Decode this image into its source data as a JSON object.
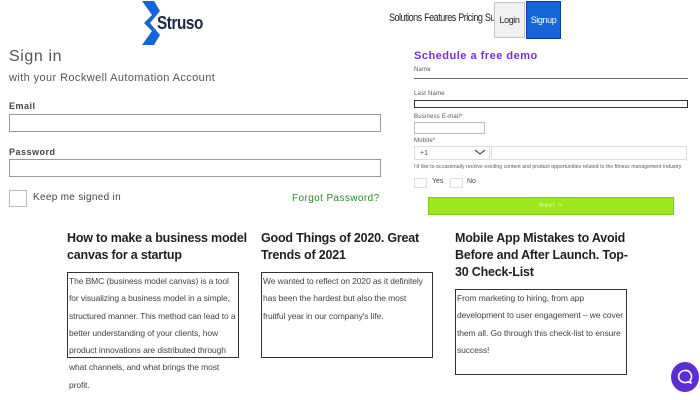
{
  "header": {
    "logo_text": "Struso",
    "nav": [
      "Solutions",
      "Features",
      "Pricing",
      "Support"
    ],
    "login_label": "Login",
    "signup_label": "Signup",
    "colors": {
      "logo_blue": "#1565d8",
      "signup_blue": "#1565d8"
    }
  },
  "signin": {
    "title": "Sign in",
    "subtitle": "with your Rockwell Automation Account",
    "email_label": "Email",
    "email_value": "",
    "password_label": "Password",
    "password_value": "",
    "keep_signed_in_label": "Keep me signed in",
    "forgot_label": "Forgot Password?"
  },
  "demo": {
    "title": "Schedule a free demo",
    "name_label": "Name",
    "lastname_label": "Last Name",
    "business_email_label": "Business E-mail*",
    "mobile_label": "Mobile*",
    "country_code": "+1",
    "consent_text": "I'd like to occasionally receive exciting content and product opportunities related to the fitness management industry",
    "yes_label": "Yes",
    "no_label": "No",
    "next_label": "Next  >",
    "colors": {
      "title": "#7b2ce0",
      "next_button": "#9be81c"
    }
  },
  "articles": [
    {
      "title": "How to make a business model canvas for a startup",
      "excerpt_lines": [
        "The BMC (business model canvas) is a tool",
        "for visualizing a business model in a simple,",
        "structured manner. This method can lead to a",
        "better understanding of your clients, how",
        "product innovations are distributed through",
        "what channels, and what brings the most",
        "profit."
      ]
    },
    {
      "title": "Good Things of 2020. Great Trends of 2021",
      "excerpt_lines": [
        "We wanted to reflect on 2020 as it definitely",
        "has been the hardest but also the most",
        "fruitful year in our company's life."
      ]
    },
    {
      "title": "Mobile App Mistakes to Avoid Before and After Launch. Top-30 Check-List",
      "excerpt_lines": [
        "From marketing to hiring, from app",
        "development to user engagement – we cover",
        "them all. Go through this check-list to ensure",
        "success!"
      ]
    }
  ],
  "chat": {
    "icon": "chat-bubble-icon",
    "color": "#5b2ed4"
  }
}
